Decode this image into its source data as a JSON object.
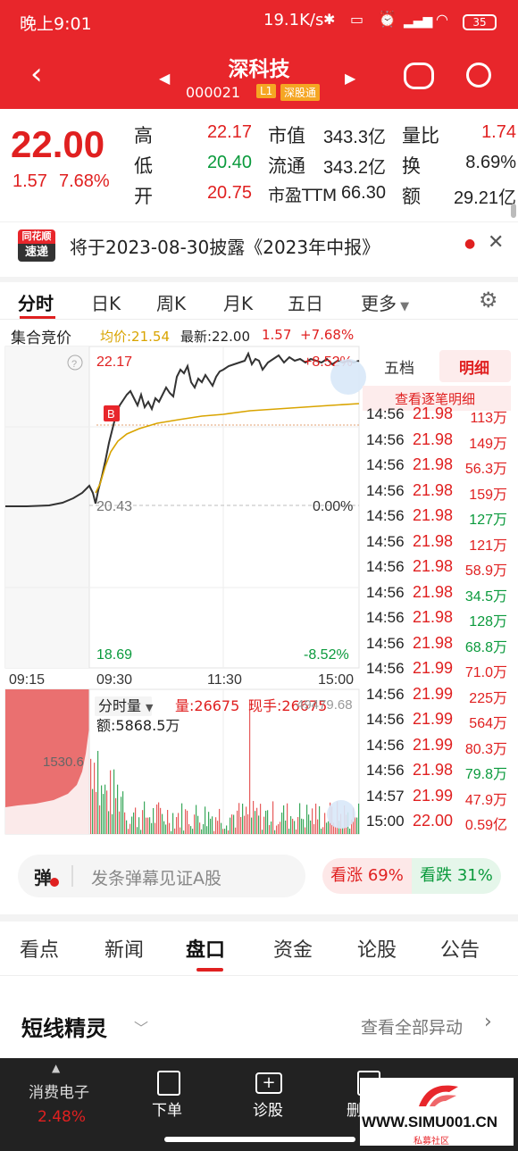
{
  "status_bar": {
    "time": "晚上9:01",
    "net_speed": "19.1K/s",
    "battery": "35"
  },
  "header": {
    "title": "深科技",
    "code": "000021",
    "level_tag": "L1",
    "connect_tag": "深股通"
  },
  "quote": {
    "price": "22.00",
    "change": "1.57",
    "change_pct": "7.68%",
    "high_label": "高",
    "high": "22.17",
    "low_label": "低",
    "low": "20.40",
    "open_label": "开",
    "open": "20.75",
    "mktcap_label": "市值",
    "mktcap": "343.3亿",
    "float_label": "流通",
    "float": "343.2亿",
    "pe_label": "市盈TTM",
    "pe": "66.30",
    "volratio_label": "量比",
    "volratio": "1.74",
    "turnover_label": "换",
    "turnover": "8.69%",
    "amount_label": "额",
    "amount": "29.21亿"
  },
  "news": {
    "logo_top": "同花顺",
    "logo_bottom": "速递",
    "text": "将于2023-08-30披露《2023年中报》"
  },
  "chart_tabs": [
    "分时",
    "日K",
    "周K",
    "月K",
    "五日",
    "更多"
  ],
  "chart": {
    "auction_label": "集合竞价",
    "avg_label": "均价:21.54",
    "latest_label": "最新:22.00",
    "latest_chg": "1.57",
    "latest_pct": "+7.68%",
    "y_top": "22.17",
    "y_top_pct": "+8.52%",
    "y_mid": "20.43",
    "y_mid_pct": "0.00%",
    "y_bottom": "18.69",
    "y_bottom_pct": "-8.52%",
    "times": [
      "09:15",
      "09:30",
      "11:30",
      "15:00"
    ],
    "buy_marker": "B",
    "vol_selector": "分时量",
    "vol_label": "量:26675",
    "hand_label": "现手:26675",
    "vol_right": "49479.68",
    "vol_auction_ref": "1530.6",
    "amount_label": "额:5868.5万"
  },
  "detail": {
    "tab_five": "五档",
    "tab_detail": "明细",
    "view_all": "查看逐笔明细",
    "rows": [
      {
        "time": "14:56",
        "price": "21.98",
        "vol": "113万",
        "dir": "red"
      },
      {
        "time": "14:56",
        "price": "21.98",
        "vol": "149万",
        "dir": "red"
      },
      {
        "time": "14:56",
        "price": "21.98",
        "vol": "56.3万",
        "dir": "red"
      },
      {
        "time": "14:56",
        "price": "21.98",
        "vol": "159万",
        "dir": "red"
      },
      {
        "time": "14:56",
        "price": "21.98",
        "vol": "127万",
        "dir": "green"
      },
      {
        "time": "14:56",
        "price": "21.98",
        "vol": "121万",
        "dir": "red"
      },
      {
        "time": "14:56",
        "price": "21.98",
        "vol": "58.9万",
        "dir": "red"
      },
      {
        "time": "14:56",
        "price": "21.98",
        "vol": "34.5万",
        "dir": "green"
      },
      {
        "time": "14:56",
        "price": "21.98",
        "vol": "128万",
        "dir": "green"
      },
      {
        "time": "14:56",
        "price": "21.98",
        "vol": "68.8万",
        "dir": "green"
      },
      {
        "time": "14:56",
        "price": "21.99",
        "vol": "71.0万",
        "dir": "red"
      },
      {
        "time": "14:56",
        "price": "21.99",
        "vol": "225万",
        "dir": "red"
      },
      {
        "time": "14:56",
        "price": "21.99",
        "vol": "564万",
        "dir": "red"
      },
      {
        "time": "14:56",
        "price": "21.99",
        "vol": "80.3万",
        "dir": "red"
      },
      {
        "time": "14:56",
        "price": "21.98",
        "vol": "79.8万",
        "dir": "green"
      },
      {
        "time": "14:57",
        "price": "21.99",
        "vol": "47.9万",
        "dir": "red"
      },
      {
        "time": "15:00",
        "price": "22.00",
        "vol": "0.59亿",
        "dir": "red"
      }
    ]
  },
  "danmaku": {
    "icon": "弹",
    "placeholder": "发条弹幕见证A股",
    "bullish": "看涨 69%",
    "bearish": "看跌 31%"
  },
  "section_tabs": [
    "看点",
    "新闻",
    "盘口",
    "资金",
    "论股",
    "公告"
  ],
  "short_spirit": {
    "title": "短线精灵",
    "view_all": "查看全部异动"
  },
  "bottom_nav": {
    "sector_name": "消费电子",
    "sector_pct": "2.48%",
    "order": "下单",
    "diagnose": "诊股",
    "delete": "删"
  },
  "watermark": {
    "site": "WWW.SIMU001.CN",
    "sub": "私募社区"
  },
  "colors": {
    "brand_red": "#e8262b",
    "up": "#e02020",
    "down": "#0a9a3c",
    "avg_line": "#d9a400"
  }
}
